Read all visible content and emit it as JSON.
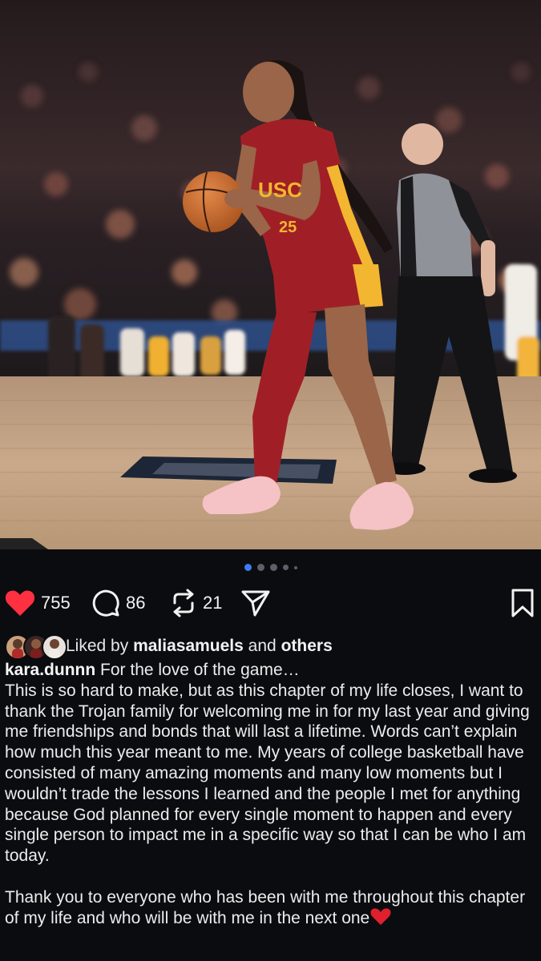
{
  "post": {
    "carousel": {
      "total": 5,
      "active_index": 0
    },
    "actions": {
      "like_count": "755",
      "comment_count": "86",
      "repost_count": "21"
    },
    "liked_by": {
      "prefix": "Liked by",
      "user": "maliasamuels",
      "conjunction": "and",
      "others": "others"
    },
    "caption": {
      "username": "kara.dunnn",
      "headline": "For the love of the game…",
      "paragraph1": "This is so hard to make, but as this chapter of my life closes, I want to thank the Trojan family for welcoming me in for my last year and giving me friendships and bonds that will last a lifetime. Words can’t explain how much this year meant to me. My years of college basketball have consisted of many amazing moments and many low moments but I wouldn’t trade the lessons I learned and the people I met for anything because God planned for every single moment to happen and every single person to impact me in a specific way so that I can be who I am today.",
      "paragraph2": "Thank you to everyone who has been with me throughout this chapter of my life and who will be with me in the next one",
      "photo_jersey_text": "USC",
      "photo_jersey_number": "25"
    },
    "colors": {
      "background": "#0b0c10",
      "like_red": "#ff3040",
      "dot_active": "#3d7bf0",
      "usc_cardinal": "#9e1b22",
      "usc_gold": "#f2b630"
    },
    "icons": [
      "heart-icon",
      "comment-icon",
      "repost-icon",
      "share-icon",
      "bookmark-icon",
      "heart-emoji-icon"
    ]
  }
}
